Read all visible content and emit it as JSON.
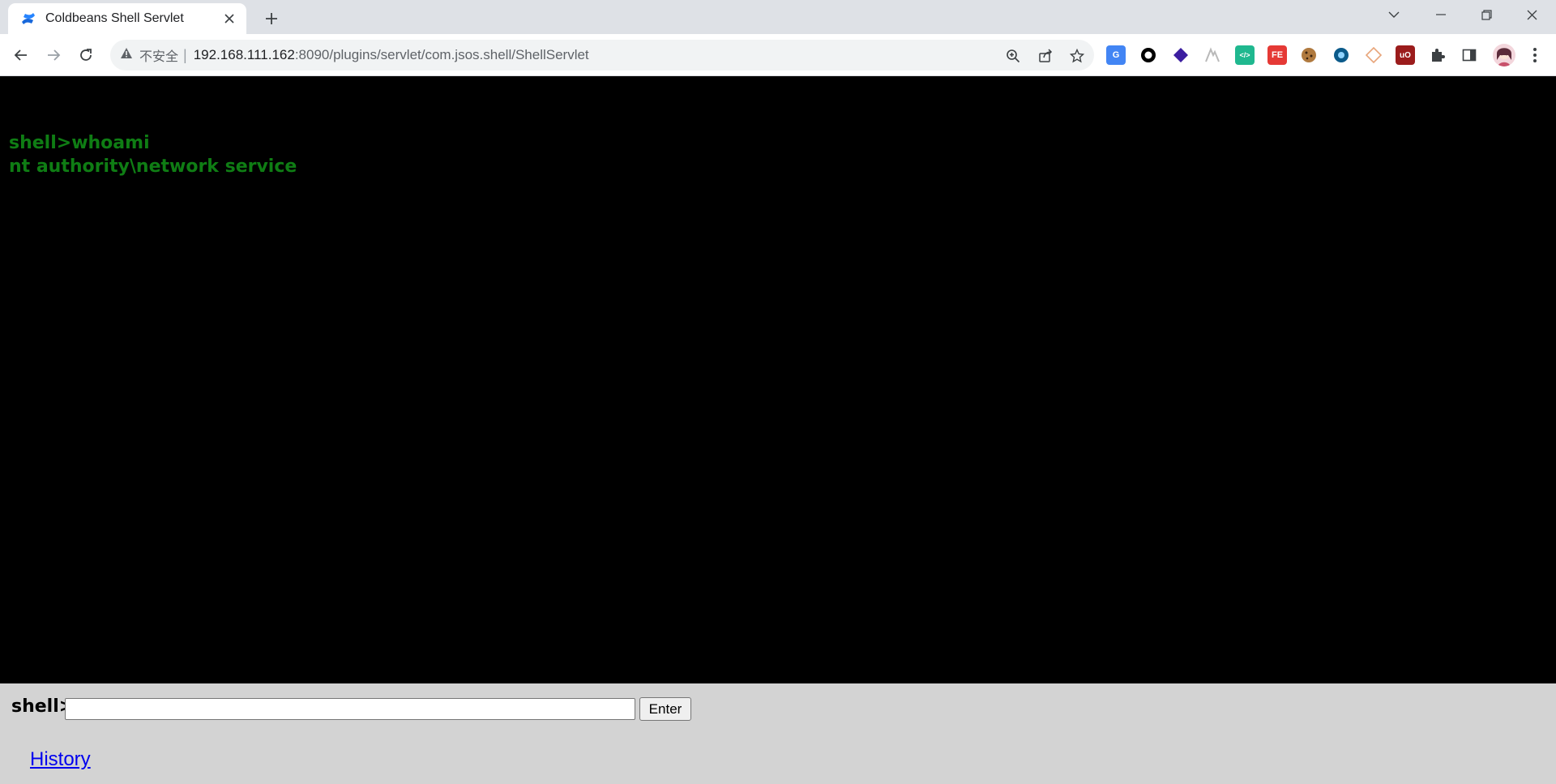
{
  "browser": {
    "tab": {
      "title": "Coldbeans Shell Servlet",
      "favicon": "confluence-icon"
    },
    "address_bar": {
      "security_label": "不安全",
      "separator": "|",
      "url_host": "192.168.111.162",
      "url_rest": ":8090/plugins/servlet/com.jsos.shell/ShellServlet"
    },
    "extensions": [
      {
        "name": "translate-extension-icon",
        "color": "#4285f4",
        "glyph": "G"
      },
      {
        "name": "circle-extension-icon",
        "color": "#000000",
        "glyph": ""
      },
      {
        "name": "layers-extension-icon",
        "color": "#3c1ea0",
        "glyph": ""
      },
      {
        "name": "mountain-extension-icon",
        "color": "#c7c7c7",
        "glyph": ""
      },
      {
        "name": "code-extension-icon",
        "color": "#1fb88f",
        "glyph": "</>"
      },
      {
        "name": "fe-extension-icon",
        "color": "#e53935",
        "glyph": "FE"
      },
      {
        "name": "cookie-extension-icon",
        "color": "#b07a3f",
        "glyph": ""
      },
      {
        "name": "vpn-extension-icon",
        "color": "#0b5a8a",
        "glyph": ""
      },
      {
        "name": "diamond-extension-icon",
        "color": "#e8a57a",
        "glyph": ""
      },
      {
        "name": "ublock-extension-icon",
        "color": "#9b1c1c",
        "glyph": "uO"
      }
    ]
  },
  "console": {
    "lines": [
      "shell>whoami",
      "nt authority\\network service"
    ],
    "text_color": "#0f7d14"
  },
  "form": {
    "prompt_label": "shell>",
    "input_value": "",
    "enter_label": "Enter",
    "history_label": "History"
  }
}
